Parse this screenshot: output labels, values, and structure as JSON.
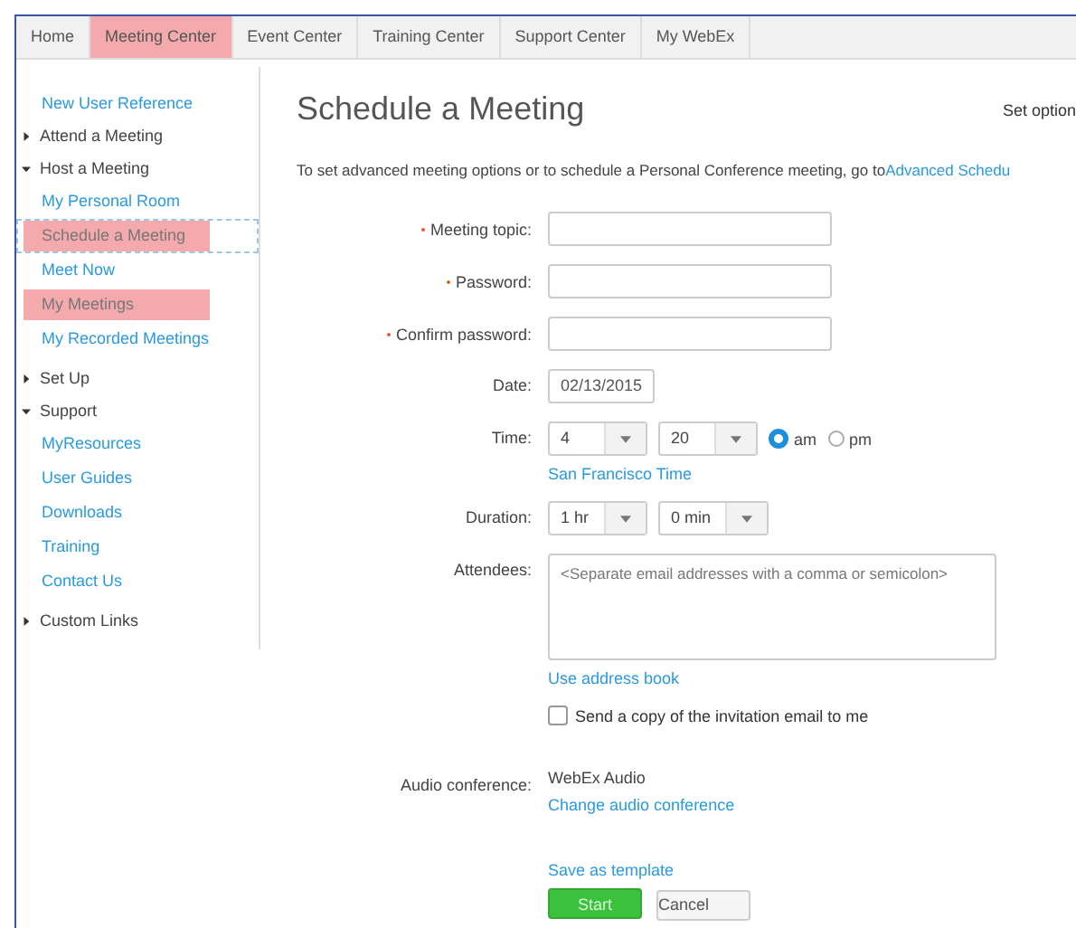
{
  "tabs": [
    {
      "label": "Home",
      "selected": false
    },
    {
      "label": "Meeting Center",
      "selected": true
    },
    {
      "label": "Event Center",
      "selected": false
    },
    {
      "label": "Training Center",
      "selected": false
    },
    {
      "label": "Support Center",
      "selected": false
    },
    {
      "label": "My WebEx",
      "selected": false
    }
  ],
  "sidebar": {
    "items": [
      {
        "kind": "link",
        "label": "New User Reference"
      },
      {
        "kind": "section",
        "label": "Attend a Meeting",
        "expanded": false
      },
      {
        "kind": "section",
        "label": "Host a Meeting",
        "expanded": true,
        "children": [
          {
            "label": "My Personal Room",
            "highlighted": false,
            "focused": false
          },
          {
            "label": "Schedule a Meeting",
            "highlighted": true,
            "focused": true
          },
          {
            "label": "Meet Now",
            "highlighted": false,
            "focused": false
          },
          {
            "label": "My Meetings",
            "highlighted": true,
            "focused": false
          },
          {
            "label": "My Recorded Meetings",
            "highlighted": false,
            "focused": false
          }
        ]
      },
      {
        "kind": "section",
        "label": "Set Up",
        "expanded": false
      },
      {
        "kind": "section",
        "label": "Support",
        "expanded": true,
        "children": [
          {
            "label": "MyResources",
            "highlighted": false,
            "focused": false
          },
          {
            "label": "User Guides",
            "highlighted": false,
            "focused": false
          },
          {
            "label": "Downloads",
            "highlighted": false,
            "focused": false
          },
          {
            "label": "Training",
            "highlighted": false,
            "focused": false
          },
          {
            "label": "Contact Us",
            "highlighted": false,
            "focused": false
          }
        ]
      },
      {
        "kind": "section",
        "label": "Custom Links",
        "expanded": false
      }
    ]
  },
  "main": {
    "title": "Schedule a Meeting",
    "top_right": "Set option",
    "intro": "To set advanced meeting options or to schedule a Personal Conference meeting, go to",
    "intro_link": "Advanced Schedu"
  },
  "form": [
    {
      "kind": "text",
      "label": "Meeting topic:",
      "required": true
    },
    {
      "kind": "text",
      "label": "Password:",
      "required": true
    },
    {
      "kind": "text",
      "label": "Confirm password:",
      "required": true
    },
    {
      "kind": "date",
      "label": "Date:",
      "value": "02/13/2015"
    },
    {
      "kind": "time",
      "label": "Time:",
      "selects": [
        "4",
        "20"
      ],
      "radios": [
        {
          "label": "am",
          "selected": true
        },
        {
          "label": "pm",
          "selected": false
        }
      ],
      "link": "San Francisco Time"
    },
    {
      "kind": "duration",
      "label": "Duration:",
      "selects": [
        "1 hr",
        "0 min"
      ]
    },
    {
      "kind": "textarea",
      "label": "Attendees:",
      "placeholder": "<Separate email addresses with a comma or semicolon>",
      "link": "Use address book"
    },
    {
      "kind": "checkbox",
      "label": "Send a copy of the invitation email to me",
      "checked": false
    },
    {
      "kind": "info",
      "label": "Audio conference:",
      "value": "WebEx Audio",
      "link": "Change audio conference"
    }
  ],
  "save_template": "Save as template",
  "buttons": [
    {
      "label": "Start",
      "kind": "primary"
    },
    {
      "label": "Cancel",
      "kind": "secondary"
    }
  ]
}
